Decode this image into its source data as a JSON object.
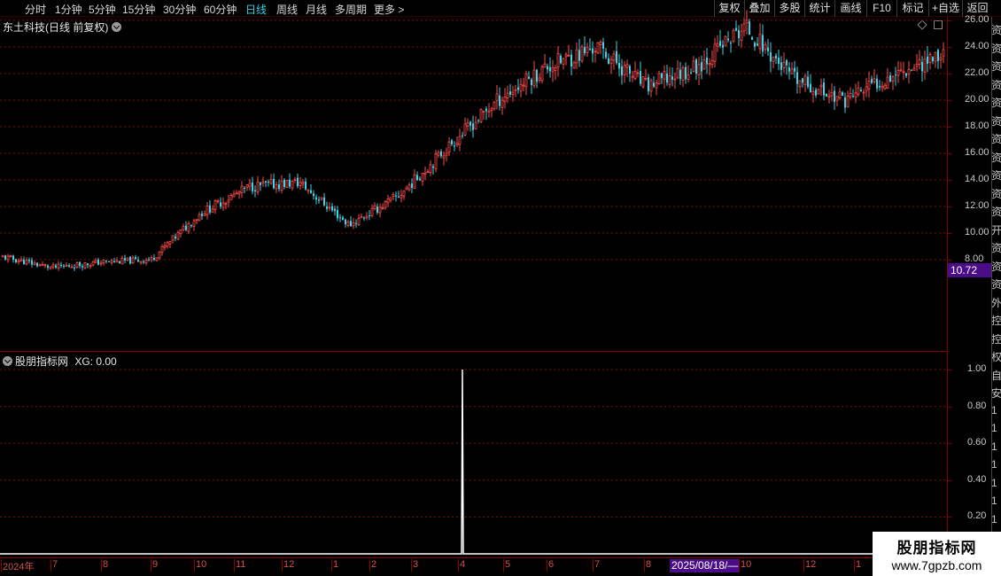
{
  "toolbar": {
    "periods": [
      "分时",
      "1分钟",
      "5分钟",
      "15分钟",
      "30分钟",
      "60分钟",
      "日线",
      "周线",
      "月线",
      "多周期",
      "更多 >"
    ],
    "active_period": "日线",
    "buttons": [
      "复权",
      "叠加",
      "多股",
      "统计",
      "画线",
      "F10",
      "标记",
      "+自选",
      "返回"
    ]
  },
  "main_chart": {
    "title": "东土科技(日线 前复权)",
    "price_label": "10.72"
  },
  "indicator": {
    "title": "股朋指标网",
    "value_text": "XG: 0.00"
  },
  "right_stub": {
    "chars": [
      "资",
      "资",
      "资",
      "资",
      "资",
      "资",
      "资",
      "资",
      "资",
      "资",
      "资",
      "开",
      "资",
      "资",
      "资",
      "外",
      "控",
      "控",
      "权",
      "自",
      "安",
      "1",
      "1",
      "1",
      "1",
      "1",
      "1",
      "1",
      "1"
    ]
  },
  "date_axis": {
    "cursor_date": "2025/08/18/—"
  },
  "watermark": {
    "line1": "股朋指标网",
    "line2": "www.7gpzb.com"
  },
  "colors": {
    "up": "#ff4a4a",
    "down": "#39d4e6",
    "grid": "#7a1010",
    "axis": "#8b0000",
    "label_bg": "#4b0c8a",
    "active_tab": "#2fd0e8"
  },
  "chart_data": [
    {
      "type": "candlestick",
      "title": "东土科技(日线 前复权)",
      "ylim": [
        6.0,
        29.0
      ],
      "y_ticks": [
        8.0,
        10.0,
        12.0,
        14.0,
        16.0,
        18.0,
        20.0,
        22.0,
        24.0,
        26.0,
        28.0
      ],
      "x_ticks": [
        "2024年",
        "7",
        "8",
        "9",
        "10",
        "11",
        "12",
        "1",
        "2",
        "3",
        "4",
        "5",
        "6",
        "7",
        "8",
        "10",
        "12",
        "1"
      ],
      "approx_closes": {
        "months": [
          "2024-06",
          "2024-07",
          "2024-08",
          "2024-09",
          "2024-10",
          "2024-11",
          "2024-12",
          "2025-01",
          "2025-02",
          "2025-03",
          "2025-04",
          "2025-05",
          "2025-06",
          "2025-07",
          "2025-08",
          "2025-09",
          "2025-10",
          "2025-11",
          "2025-12",
          "2026-01"
        ],
        "values": [
          8.2,
          7.4,
          7.8,
          8.0,
          11.5,
          13.5,
          13.8,
          10.6,
          12.8,
          16.5,
          20.0,
          22.5,
          24.0,
          21.0,
          22.5,
          25.5,
          21.5,
          20.0,
          22.0,
          23.5
        ]
      }
    },
    {
      "type": "line",
      "title": "股朋指标网",
      "series": [
        {
          "name": "XG",
          "last": 0.0,
          "spike": {
            "x": "4",
            "value": 1.0
          }
        }
      ],
      "ylim": [
        0.0,
        1.0
      ],
      "y_ticks": [
        0.2,
        0.4,
        0.6,
        0.8,
        1.0
      ]
    }
  ]
}
